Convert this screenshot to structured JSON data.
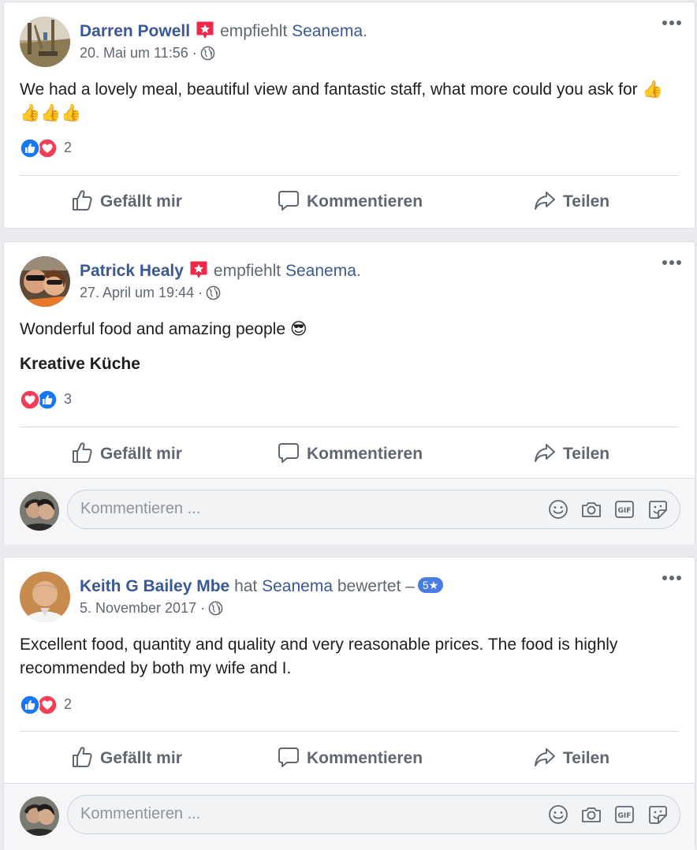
{
  "posts": [
    {
      "author": "Darren Powell",
      "verb": "empfiehlt",
      "page": "Seanema",
      "tail": ".",
      "timestamp": "20. Mai um 11:56",
      "sep": "·",
      "text": "We had a lovely meal, beautiful view and fantastic staff, what more could you ask for 👍👍👍👍",
      "reaction_count": "2",
      "actions": {
        "like": "Gefällt mir",
        "comment": "Kommentieren",
        "share": "Teilen"
      }
    },
    {
      "author": "Patrick Healy",
      "verb": "empfiehlt",
      "page": "Seanema",
      "tail": ".",
      "timestamp": "27. April um 19:44",
      "sep": "·",
      "text": "Wonderful food and amazing people 😎",
      "tag": "Kreative Küche",
      "reaction_count": "3",
      "actions": {
        "like": "Gefällt mir",
        "comment": "Kommentieren",
        "share": "Teilen"
      },
      "comment_placeholder": "Kommentieren ..."
    },
    {
      "author": "Keith G Bailey Mbe",
      "verb": "hat",
      "page": "Seanema",
      "tail": "bewertet –",
      "rating": "5★",
      "timestamp": "5. November 2017",
      "sep": "·",
      "text": "Excellent food, quantity and quality and very reasonable prices. The food is highly recommended by both my wife and I.",
      "reaction_count": "2",
      "actions": {
        "like": "Gefällt mir",
        "comment": "Kommentieren",
        "share": "Teilen"
      },
      "comment_placeholder": "Kommentieren ..."
    }
  ],
  "colors": {
    "link": "#385898",
    "meta": "#606770",
    "like_blue": "#1877f2",
    "love_red": "#f33e58",
    "badge": "#4a7de2"
  },
  "icons": [
    "recommend-badge-icon",
    "globe-icon",
    "more-icon",
    "like-reaction-icon",
    "love-reaction-icon",
    "thumbs-up-icon",
    "comment-icon",
    "share-icon",
    "emoji-icon",
    "camera-icon",
    "gif-icon",
    "sticker-icon"
  ]
}
